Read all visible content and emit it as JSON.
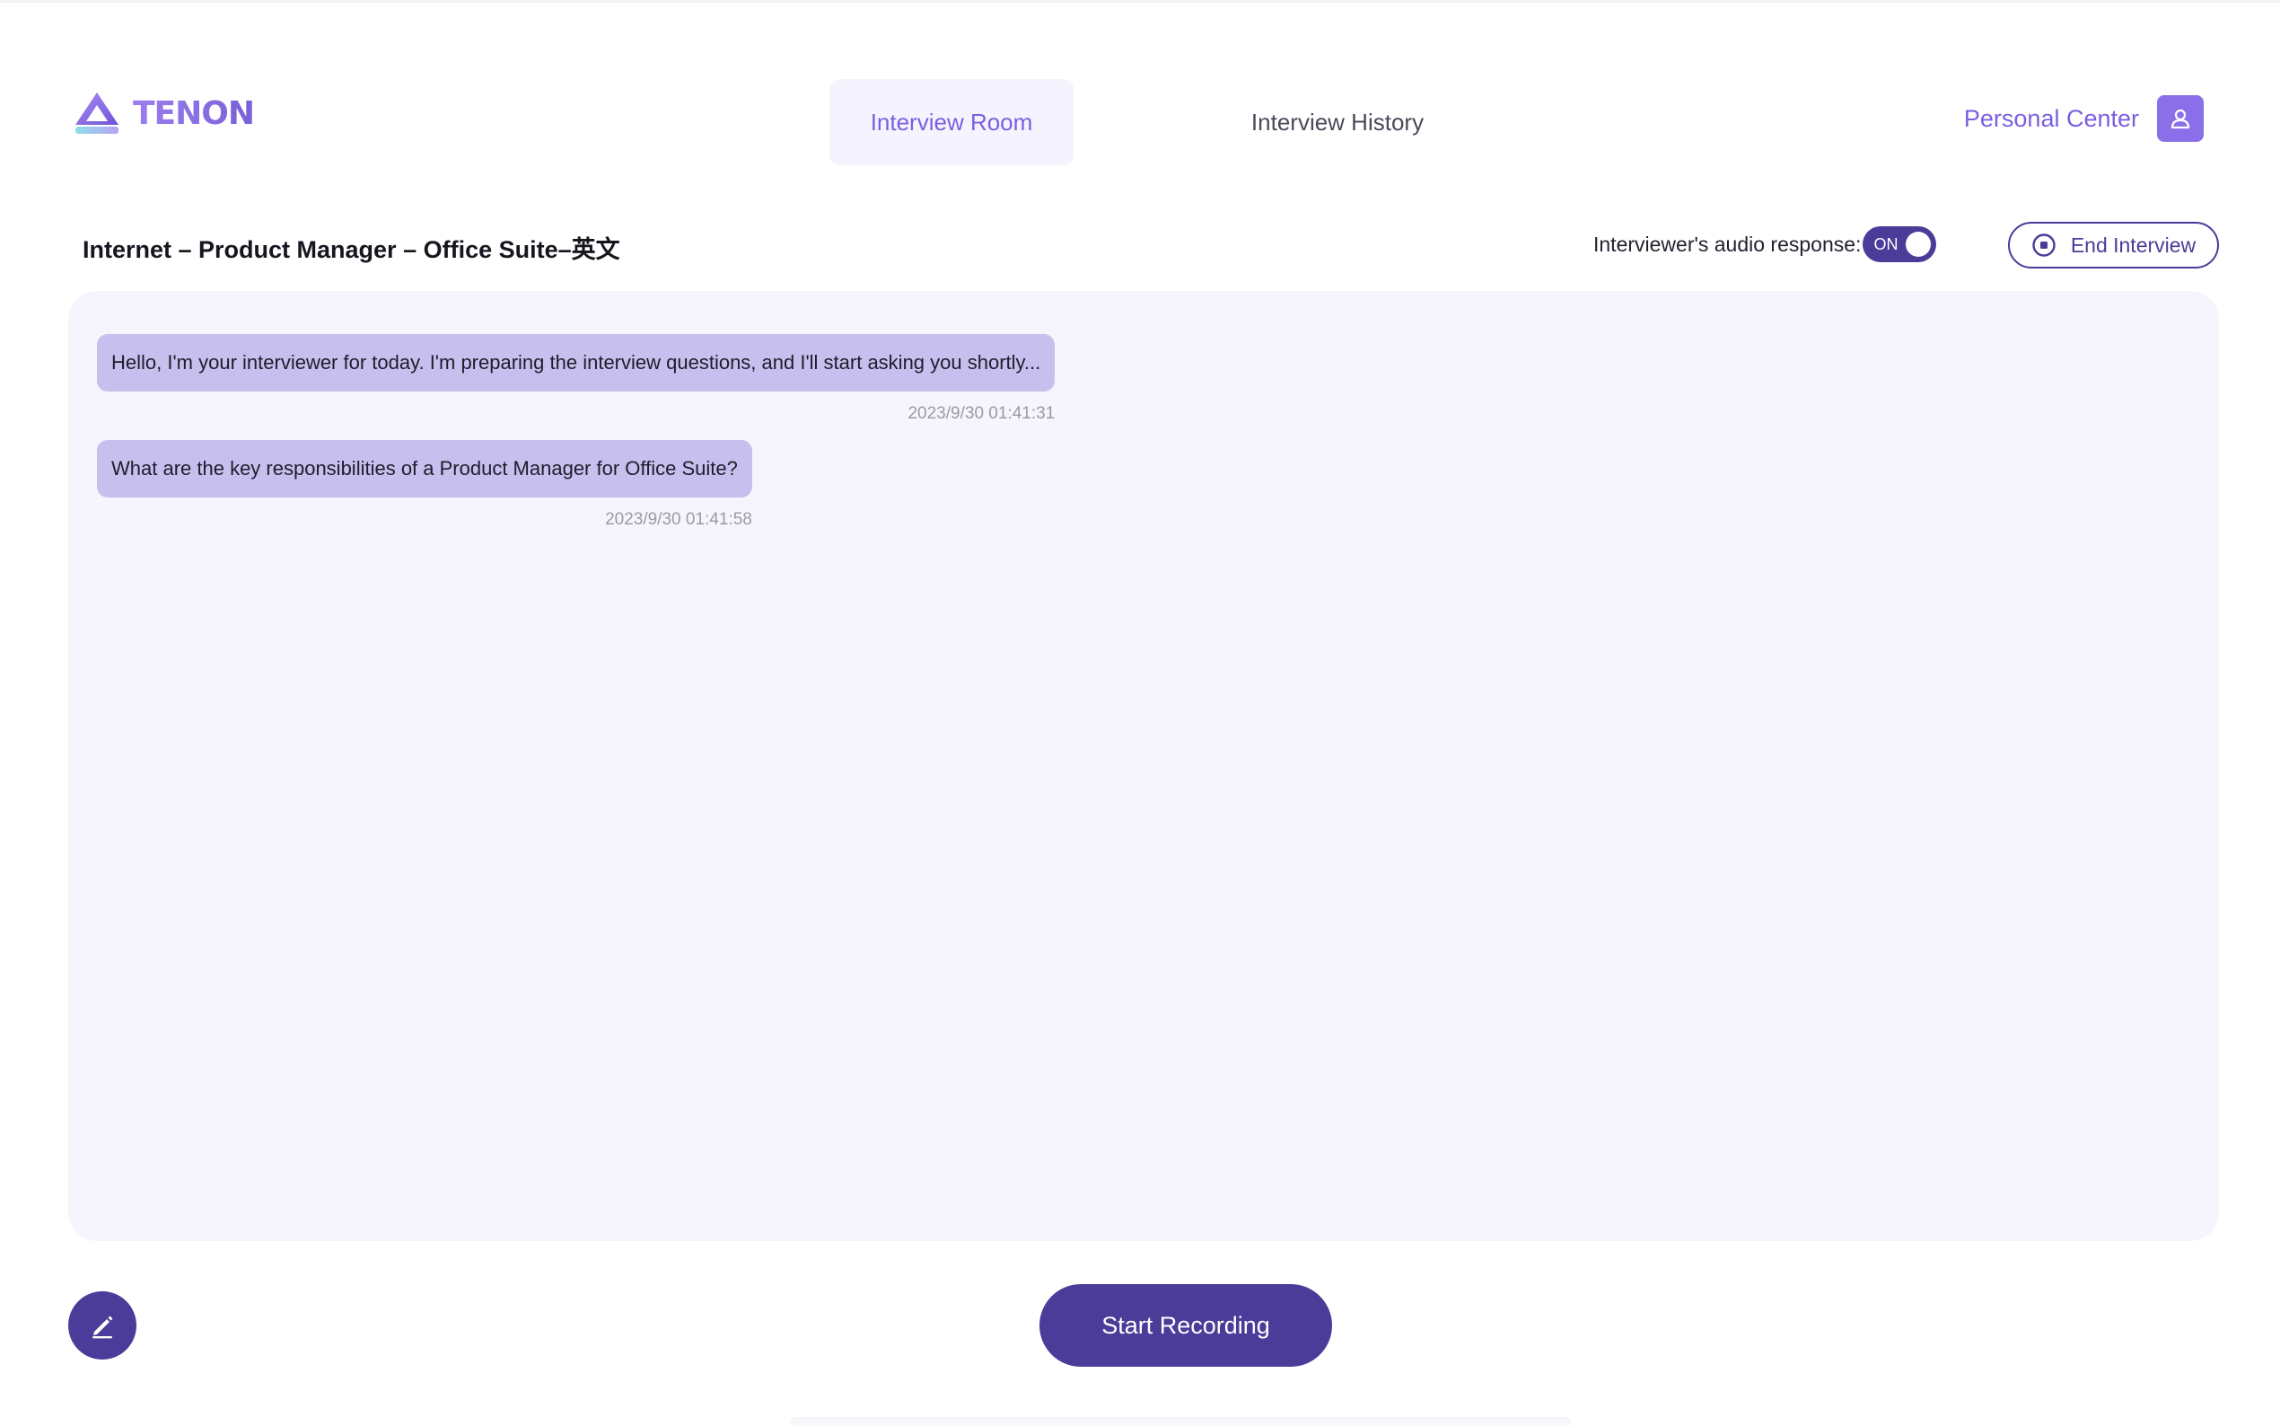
{
  "brand": {
    "name": "TENON",
    "icon": "triangle-logo-icon"
  },
  "nav": {
    "tabs": [
      {
        "label": "Interview Room",
        "active": true
      },
      {
        "label": "Interview History",
        "active": false
      }
    ],
    "personal_center": "Personal Center",
    "avatar_icon": "user-icon"
  },
  "session": {
    "title": "Internet – Product Manager – Office Suite–英文",
    "audio_label": "Interviewer's audio response:",
    "audio_toggle": "ON",
    "end_label": "End Interview",
    "end_icon": "stop-circle-icon"
  },
  "messages": [
    {
      "text": "Hello, I'm your interviewer for today. I'm preparing the interview questions, and I'll start asking you shortly...",
      "time": "2023/9/30 01:41:31"
    },
    {
      "text": "What are the key responsibilities of a Product Manager for Office Suite?",
      "time": "2023/9/30 01:41:58"
    }
  ],
  "actions": {
    "record_label": "Start Recording",
    "edit_icon": "pencil-icon"
  },
  "colors": {
    "accent": "#7b5fe0",
    "primary_dark": "#4b3c99",
    "bubble": "#c7bfee",
    "panel_bg": "#f6f5fd"
  }
}
